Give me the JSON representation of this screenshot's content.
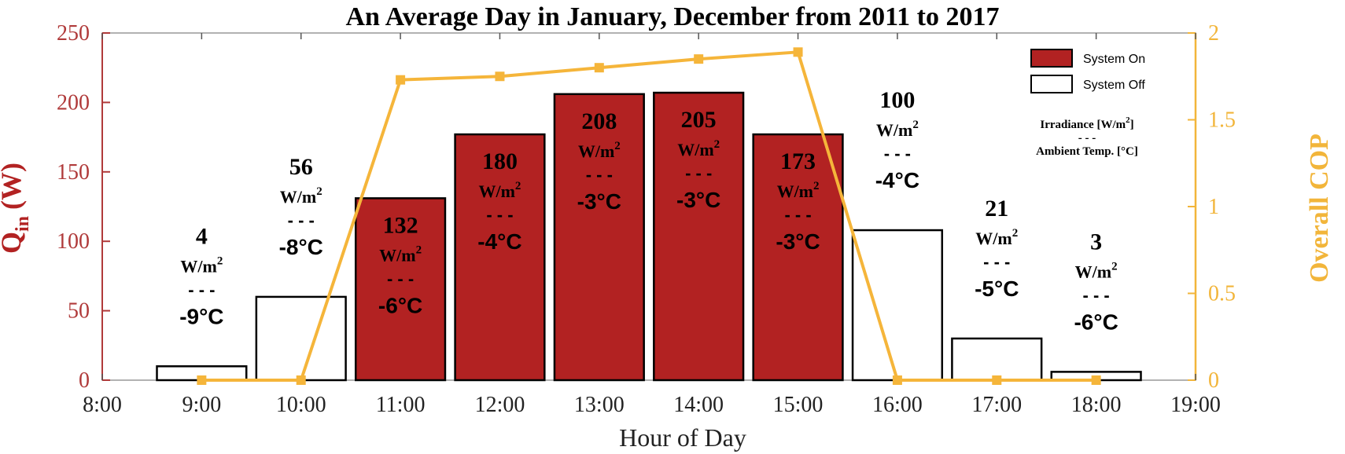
{
  "chart_data": {
    "type": "bar",
    "title": "An Average Day in January, December from 2011 to 2017",
    "xlabel": "Hour of Day",
    "ylabel_left": {
      "main": "Q",
      "sub": "in",
      "unit": "(W)"
    },
    "ylabel_right": "Overall COP",
    "x_ticks": [
      "8:00",
      "9:00",
      "10:00",
      "11:00",
      "12:00",
      "13:00",
      "14:00",
      "15:00",
      "16:00",
      "17:00",
      "18:00",
      "19:00"
    ],
    "y_left_ticks": [
      "0",
      "50",
      "100",
      "150",
      "200",
      "250"
    ],
    "y_right_ticks": [
      "0",
      "0.5",
      "1",
      "1.5",
      "2"
    ],
    "ylim_left": [
      0,
      250
    ],
    "ylim_right": [
      0,
      2
    ],
    "categories": [
      "9:00",
      "10:00",
      "11:00",
      "12:00",
      "13:00",
      "14:00",
      "15:00",
      "16:00",
      "17:00",
      "18:00"
    ],
    "q_in": [
      10,
      60,
      131,
      177,
      206,
      207,
      177,
      108,
      30,
      6
    ],
    "system_on": [
      false,
      false,
      true,
      true,
      true,
      true,
      true,
      false,
      false,
      false
    ],
    "cop": [
      0,
      0,
      1.73,
      1.75,
      1.8,
      1.85,
      1.89,
      0,
      0,
      0
    ],
    "annotations": [
      {
        "irradiance": "4",
        "unit": "W/m",
        "sup": "2",
        "sep": "- - -",
        "temp": "-9°C"
      },
      {
        "irradiance": "56",
        "unit": "W/m",
        "sup": "2",
        "sep": "- - -",
        "temp": "-8°C"
      },
      {
        "irradiance": "132",
        "unit": "W/m",
        "sup": "2",
        "sep": "- - -",
        "temp": "-6°C"
      },
      {
        "irradiance": "180",
        "unit": "W/m",
        "sup": "2",
        "sep": "- - -",
        "temp": "-4°C"
      },
      {
        "irradiance": "208",
        "unit": "W/m",
        "sup": "2",
        "sep": "- - -",
        "temp": "-3°C"
      },
      {
        "irradiance": "205",
        "unit": "W/m",
        "sup": "2",
        "sep": "- - -",
        "temp": "-3°C"
      },
      {
        "irradiance": "173",
        "unit": "W/m",
        "sup": "2",
        "sep": "- - -",
        "temp": "-3°C"
      },
      {
        "irradiance": "100",
        "unit": "W/m",
        "sup": "2",
        "sep": "- - -",
        "temp": "-4°C"
      },
      {
        "irradiance": "21",
        "unit": "W/m",
        "sup": "2",
        "sep": "- - -",
        "temp": "-5°C"
      },
      {
        "irradiance": "3",
        "unit": "W/m",
        "sup": "2",
        "sep": "- - -",
        "temp": "-6°C"
      }
    ],
    "legend": {
      "placement": "top-right",
      "items": [
        {
          "label": "System On",
          "color": "#b22222"
        },
        {
          "label": "System Off",
          "color": "#ffffff"
        }
      ]
    },
    "key": {
      "line1": "Irradiance [W/m",
      "line1_sup": "2",
      "line1_end": "]",
      "line2": "- - -",
      "line3": "Ambient Temp. [°C]"
    },
    "colors": {
      "bar_on": "#b22222",
      "bar_off": "#ffffff",
      "cop_line": "#f5b53a",
      "left_axis": "#b03a3a",
      "right_axis": "#f2b53a"
    }
  }
}
